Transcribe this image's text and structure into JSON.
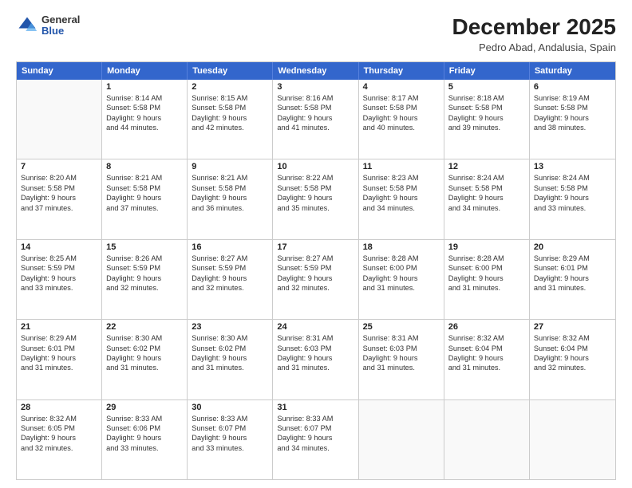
{
  "header": {
    "logo": {
      "general": "General",
      "blue": "Blue"
    },
    "title": "December 2025",
    "location": "Pedro Abad, Andalusia, Spain"
  },
  "days_of_week": [
    "Sunday",
    "Monday",
    "Tuesday",
    "Wednesday",
    "Thursday",
    "Friday",
    "Saturday"
  ],
  "weeks": [
    [
      {
        "day": "",
        "empty": true
      },
      {
        "day": "1",
        "sunrise": "Sunrise: 8:14 AM",
        "sunset": "Sunset: 5:58 PM",
        "daylight": "Daylight: 9 hours",
        "daylight2": "and 44 minutes."
      },
      {
        "day": "2",
        "sunrise": "Sunrise: 8:15 AM",
        "sunset": "Sunset: 5:58 PM",
        "daylight": "Daylight: 9 hours",
        "daylight2": "and 42 minutes."
      },
      {
        "day": "3",
        "sunrise": "Sunrise: 8:16 AM",
        "sunset": "Sunset: 5:58 PM",
        "daylight": "Daylight: 9 hours",
        "daylight2": "and 41 minutes."
      },
      {
        "day": "4",
        "sunrise": "Sunrise: 8:17 AM",
        "sunset": "Sunset: 5:58 PM",
        "daylight": "Daylight: 9 hours",
        "daylight2": "and 40 minutes."
      },
      {
        "day": "5",
        "sunrise": "Sunrise: 8:18 AM",
        "sunset": "Sunset: 5:58 PM",
        "daylight": "Daylight: 9 hours",
        "daylight2": "and 39 minutes."
      },
      {
        "day": "6",
        "sunrise": "Sunrise: 8:19 AM",
        "sunset": "Sunset: 5:58 PM",
        "daylight": "Daylight: 9 hours",
        "daylight2": "and 38 minutes."
      }
    ],
    [
      {
        "day": "7",
        "sunrise": "Sunrise: 8:20 AM",
        "sunset": "Sunset: 5:58 PM",
        "daylight": "Daylight: 9 hours",
        "daylight2": "and 37 minutes."
      },
      {
        "day": "8",
        "sunrise": "Sunrise: 8:21 AM",
        "sunset": "Sunset: 5:58 PM",
        "daylight": "Daylight: 9 hours",
        "daylight2": "and 37 minutes."
      },
      {
        "day": "9",
        "sunrise": "Sunrise: 8:21 AM",
        "sunset": "Sunset: 5:58 PM",
        "daylight": "Daylight: 9 hours",
        "daylight2": "and 36 minutes."
      },
      {
        "day": "10",
        "sunrise": "Sunrise: 8:22 AM",
        "sunset": "Sunset: 5:58 PM",
        "daylight": "Daylight: 9 hours",
        "daylight2": "and 35 minutes."
      },
      {
        "day": "11",
        "sunrise": "Sunrise: 8:23 AM",
        "sunset": "Sunset: 5:58 PM",
        "daylight": "Daylight: 9 hours",
        "daylight2": "and 34 minutes."
      },
      {
        "day": "12",
        "sunrise": "Sunrise: 8:24 AM",
        "sunset": "Sunset: 5:58 PM",
        "daylight": "Daylight: 9 hours",
        "daylight2": "and 34 minutes."
      },
      {
        "day": "13",
        "sunrise": "Sunrise: 8:24 AM",
        "sunset": "Sunset: 5:58 PM",
        "daylight": "Daylight: 9 hours",
        "daylight2": "and 33 minutes."
      }
    ],
    [
      {
        "day": "14",
        "sunrise": "Sunrise: 8:25 AM",
        "sunset": "Sunset: 5:59 PM",
        "daylight": "Daylight: 9 hours",
        "daylight2": "and 33 minutes."
      },
      {
        "day": "15",
        "sunrise": "Sunrise: 8:26 AM",
        "sunset": "Sunset: 5:59 PM",
        "daylight": "Daylight: 9 hours",
        "daylight2": "and 32 minutes."
      },
      {
        "day": "16",
        "sunrise": "Sunrise: 8:27 AM",
        "sunset": "Sunset: 5:59 PM",
        "daylight": "Daylight: 9 hours",
        "daylight2": "and 32 minutes."
      },
      {
        "day": "17",
        "sunrise": "Sunrise: 8:27 AM",
        "sunset": "Sunset: 5:59 PM",
        "daylight": "Daylight: 9 hours",
        "daylight2": "and 32 minutes."
      },
      {
        "day": "18",
        "sunrise": "Sunrise: 8:28 AM",
        "sunset": "Sunset: 6:00 PM",
        "daylight": "Daylight: 9 hours",
        "daylight2": "and 31 minutes."
      },
      {
        "day": "19",
        "sunrise": "Sunrise: 8:28 AM",
        "sunset": "Sunset: 6:00 PM",
        "daylight": "Daylight: 9 hours",
        "daylight2": "and 31 minutes."
      },
      {
        "day": "20",
        "sunrise": "Sunrise: 8:29 AM",
        "sunset": "Sunset: 6:01 PM",
        "daylight": "Daylight: 9 hours",
        "daylight2": "and 31 minutes."
      }
    ],
    [
      {
        "day": "21",
        "sunrise": "Sunrise: 8:29 AM",
        "sunset": "Sunset: 6:01 PM",
        "daylight": "Daylight: 9 hours",
        "daylight2": "and 31 minutes."
      },
      {
        "day": "22",
        "sunrise": "Sunrise: 8:30 AM",
        "sunset": "Sunset: 6:02 PM",
        "daylight": "Daylight: 9 hours",
        "daylight2": "and 31 minutes."
      },
      {
        "day": "23",
        "sunrise": "Sunrise: 8:30 AM",
        "sunset": "Sunset: 6:02 PM",
        "daylight": "Daylight: 9 hours",
        "daylight2": "and 31 minutes."
      },
      {
        "day": "24",
        "sunrise": "Sunrise: 8:31 AM",
        "sunset": "Sunset: 6:03 PM",
        "daylight": "Daylight: 9 hours",
        "daylight2": "and 31 minutes."
      },
      {
        "day": "25",
        "sunrise": "Sunrise: 8:31 AM",
        "sunset": "Sunset: 6:03 PM",
        "daylight": "Daylight: 9 hours",
        "daylight2": "and 31 minutes."
      },
      {
        "day": "26",
        "sunrise": "Sunrise: 8:32 AM",
        "sunset": "Sunset: 6:04 PM",
        "daylight": "Daylight: 9 hours",
        "daylight2": "and 31 minutes."
      },
      {
        "day": "27",
        "sunrise": "Sunrise: 8:32 AM",
        "sunset": "Sunset: 6:04 PM",
        "daylight": "Daylight: 9 hours",
        "daylight2": "and 32 minutes."
      }
    ],
    [
      {
        "day": "28",
        "sunrise": "Sunrise: 8:32 AM",
        "sunset": "Sunset: 6:05 PM",
        "daylight": "Daylight: 9 hours",
        "daylight2": "and 32 minutes."
      },
      {
        "day": "29",
        "sunrise": "Sunrise: 8:33 AM",
        "sunset": "Sunset: 6:06 PM",
        "daylight": "Daylight: 9 hours",
        "daylight2": "and 33 minutes."
      },
      {
        "day": "30",
        "sunrise": "Sunrise: 8:33 AM",
        "sunset": "Sunset: 6:07 PM",
        "daylight": "Daylight: 9 hours",
        "daylight2": "and 33 minutes."
      },
      {
        "day": "31",
        "sunrise": "Sunrise: 8:33 AM",
        "sunset": "Sunset: 6:07 PM",
        "daylight": "Daylight: 9 hours",
        "daylight2": "and 34 minutes."
      },
      {
        "day": "",
        "empty": true
      },
      {
        "day": "",
        "empty": true
      },
      {
        "day": "",
        "empty": true
      }
    ]
  ]
}
